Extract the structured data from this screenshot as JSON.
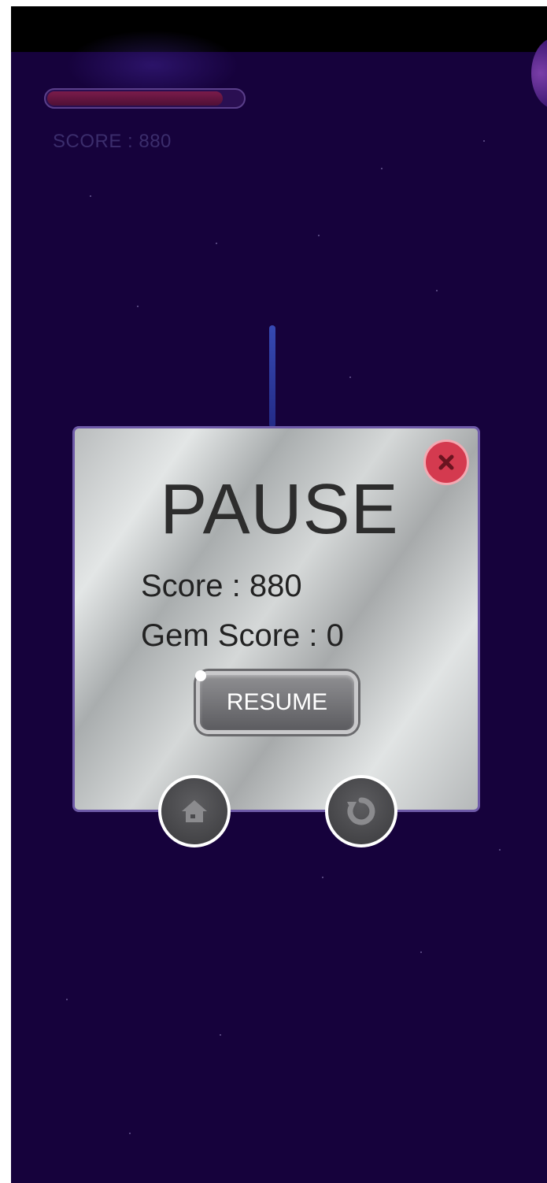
{
  "hud": {
    "score_text": "SCORE : 880",
    "health_fraction": 0.9
  },
  "pause_dialog": {
    "title": "PAUSE",
    "score_text": "Score : 880",
    "gem_score_text": "Gem Score : 0",
    "resume_label": "RESUME",
    "close_icon": "close-x-icon",
    "home_icon": "home-icon",
    "restart_icon": "restart-icon"
  },
  "colors": {
    "background": "#16023c",
    "health_fill": "#7a1b4a",
    "close_button": "#d43a4f"
  }
}
